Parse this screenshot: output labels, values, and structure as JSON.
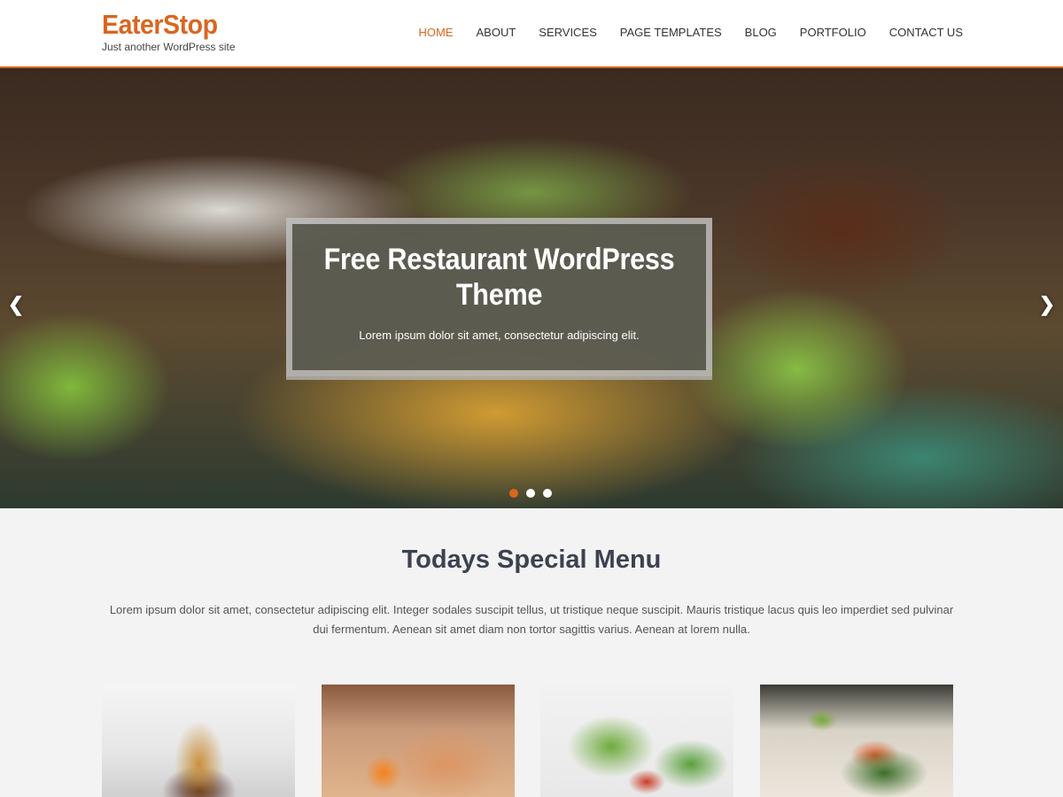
{
  "header": {
    "site_title": "EaterStop",
    "tagline": "Just another WordPress site",
    "nav": [
      {
        "label": "HOME",
        "active": true
      },
      {
        "label": "ABOUT"
      },
      {
        "label": "SERVICES"
      },
      {
        "label": "PAGE TEMPLATES"
      },
      {
        "label": "BLOG"
      },
      {
        "label": "PORTFOLIO"
      },
      {
        "label": "CONTACT US"
      }
    ]
  },
  "hero": {
    "title": "Free Restaurant WordPress Theme",
    "subtitle": "Lorem ipsum dolor sit amet, consectetur adipiscing elit.",
    "prev_icon": "chevron-left-icon",
    "next_icon": "chevron-right-icon",
    "slides_count": 3,
    "active_slide": 1
  },
  "special_menu": {
    "title": "Todays Special Menu",
    "description": "Lorem ipsum dolor sit amet, consectetur adipiscing elit. Integer sodales suscipit tellus, ut tristique neque suscipit. Mauris tristique lacus quis leo imperdiet sed pulvinar dui fermentum. Aenean sit amet diam non tortor sagittis varius. Aenean at lorem nulla."
  },
  "colors": {
    "accent": "#d9661f",
    "background": "#f3f3f3"
  }
}
